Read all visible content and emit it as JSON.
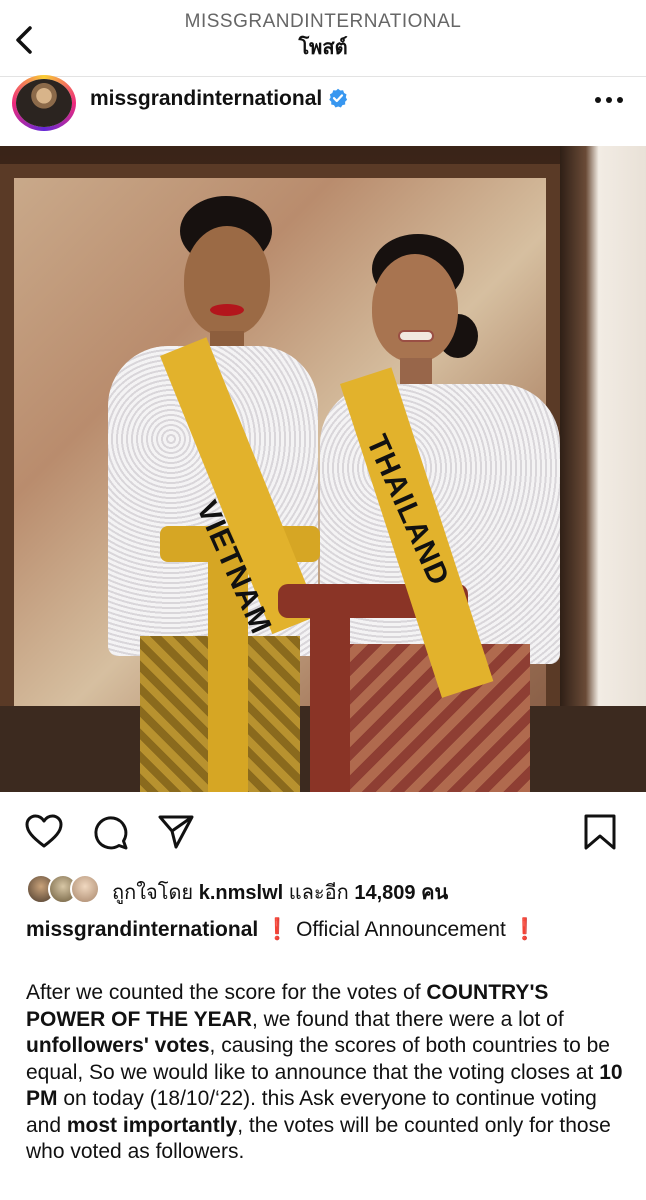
{
  "header": {
    "account_label": "MISSGRANDINTERNATIONAL",
    "page_title": "โพสต์"
  },
  "post": {
    "username": "missgrandinternational",
    "verified": true,
    "image": {
      "sash_left": "VIETNAM",
      "sash_right": "THAILAND"
    }
  },
  "actions": {
    "icons": [
      "heart-icon",
      "comment-icon",
      "share-icon",
      "bookmark-icon"
    ]
  },
  "likes": {
    "prefix": "ถูกใจโดย",
    "user": "k.nmslwl",
    "middle": "และอีก",
    "count": "14,809",
    "suffix": "คน"
  },
  "caption": {
    "username": "missgrandinternational",
    "mark": "❗",
    "headline": "Official Announcement",
    "p1": "After we counted the score for the votes of ",
    "b1": "COUNTRY'S POWER OF THE YEAR",
    "p2": ", we found that there were a lot of ",
    "b2": "unfollowers' votes",
    "p3": ", causing the scores of both countries to be equal, So we would like to announce that the voting closes at ",
    "b3": "10 PM",
    "p4": " on today (18/10/‘22). this Ask everyone to continue voting and ",
    "b4": "most importantly",
    "p5": ", the votes will be counted only for those who voted as followers."
  },
  "colors": {
    "verified_blue": "#3897f0",
    "sash_yellow": "#e2b22c",
    "exclamation_red": "#e0241b"
  }
}
